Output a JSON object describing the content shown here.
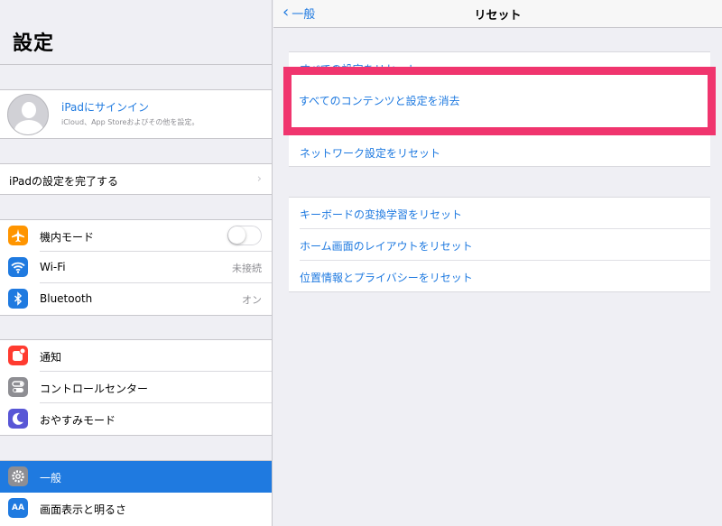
{
  "sidebar": {
    "title": "設定",
    "profile": {
      "name": "iPadにサインイン",
      "subtitle": "iCloud、App Storeおよびその他を設定。"
    },
    "setup": {
      "label": "iPadの設定を完了する"
    },
    "connectivity": [
      {
        "label": "機内モード",
        "icon": "airplane-icon",
        "color": "#ff9500",
        "toggle": "off"
      },
      {
        "label": "Wi-Fi",
        "icon": "wifi-icon",
        "color": "#1f7ae0",
        "value": "未接続"
      },
      {
        "label": "Bluetooth",
        "icon": "bluetooth-icon",
        "color": "#1f7ae0",
        "value": "オン"
      }
    ],
    "system": [
      {
        "label": "通知",
        "icon": "notifications-icon",
        "color": "#ff3b30"
      },
      {
        "label": "コントロールセンター",
        "icon": "control-center-icon",
        "color": "#8e8e93"
      },
      {
        "label": "おやすみモード",
        "icon": "moon-icon",
        "color": "#5856d6"
      }
    ],
    "general": [
      {
        "label": "一般",
        "icon": "gear-icon",
        "color": "#8e8e93",
        "selected": true
      },
      {
        "label": "画面表示と明るさ",
        "icon": "display-icon",
        "color": "#1f7ae0",
        "icon_text": "AA"
      }
    ]
  },
  "main": {
    "back_label": "一般",
    "title": "リセット",
    "group1": [
      {
        "label": "すべての設定をリセット"
      },
      {
        "label": "すべてのコンテンツと設定を消去",
        "highlighted": true
      },
      {
        "label": "ネットワーク設定をリセット"
      }
    ],
    "group2": [
      {
        "label": "キーボードの変換学習をリセット"
      },
      {
        "label": "ホーム画面のレイアウトをリセット"
      },
      {
        "label": "位置情報とプライバシーをリセット"
      }
    ]
  },
  "colors": {
    "accent": "#1f7ae0",
    "highlight": "#f0356e",
    "background": "#efeff4"
  }
}
